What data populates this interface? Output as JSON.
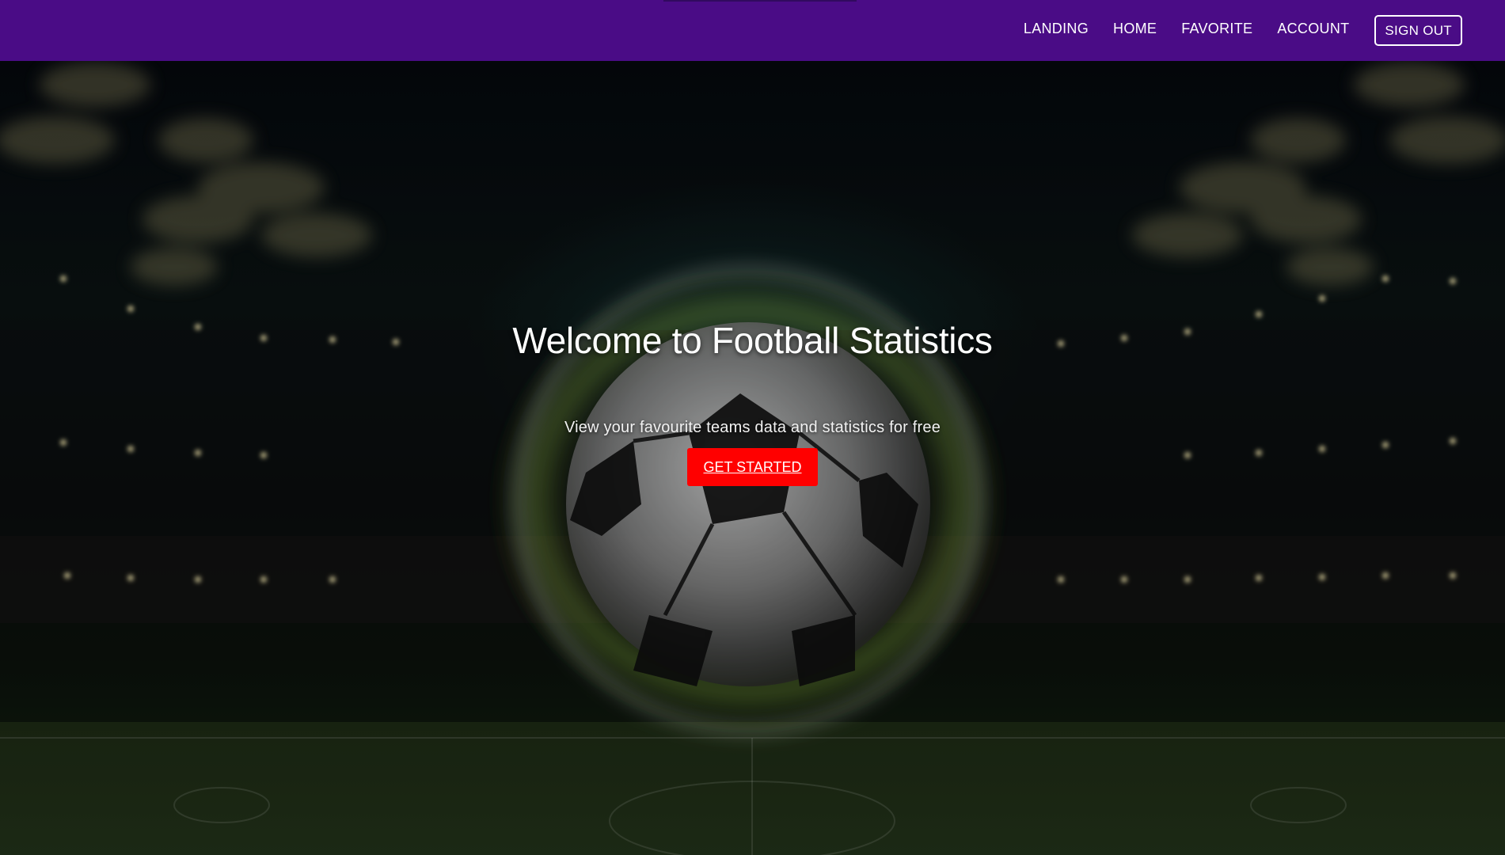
{
  "nav": {
    "links": [
      {
        "label": "LANDING"
      },
      {
        "label": "HOME"
      },
      {
        "label": "FAVORITE"
      },
      {
        "label": "ACCOUNT"
      }
    ],
    "sign_out_label": "SIGN OUT"
  },
  "hero": {
    "title": "Welcome to Football Statistics",
    "subtitle": "View your favourite teams data and statistics for free",
    "cta_label": "GET STARTED",
    "background_image": "football-stadium-ball-image"
  },
  "colors": {
    "navbar": "#4a0c86",
    "cta": "#ff0000",
    "text": "#ffffff"
  }
}
